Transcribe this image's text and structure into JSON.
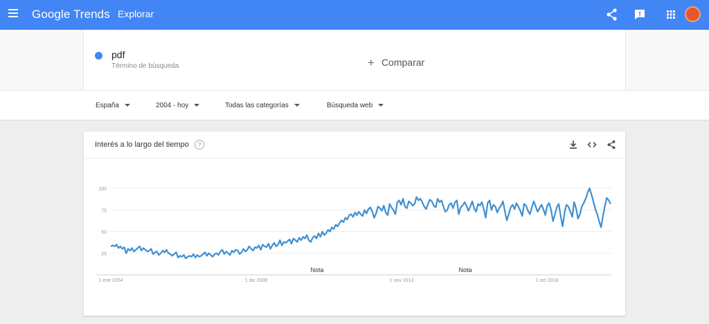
{
  "topbar": {
    "logo_google": "Google",
    "logo_trends": "Trends",
    "explore_label": "Explorar",
    "icons": [
      "menu-icon",
      "share-icon",
      "feedback-icon",
      "apps-icon",
      "avatar"
    ]
  },
  "term": {
    "name": "pdf",
    "subtitle": "Término de búsqueda",
    "color": "#4285f4",
    "compare_label": "Comparar"
  },
  "filters": {
    "region": "España",
    "period": "2004 - hoy",
    "category": "Todas las categorías",
    "search_type": "Búsqueda web"
  },
  "card": {
    "title": "Interés a lo largo del tiempo",
    "icons": [
      "download-icon",
      "embed-icon",
      "share-icon"
    ]
  },
  "chart_data": {
    "type": "line",
    "title": "",
    "xlabel": "",
    "ylabel": "",
    "x_tick_labels": [
      "1 ene 2004",
      "1 dic 2008",
      "1 nov 2013",
      "1 oct 2018"
    ],
    "y_ticks": [
      25,
      50,
      75,
      100
    ],
    "ylim": [
      0,
      100
    ],
    "grid": true,
    "annotations": [
      "Nota",
      "Nota"
    ],
    "series": [
      {
        "name": "pdf",
        "color": "#3d8fd1",
        "values": [
          33,
          34,
          33,
          35,
          31,
          33,
          30,
          32,
          25,
          30,
          28,
          31,
          27,
          29,
          31,
          33,
          28,
          31,
          29,
          27,
          28,
          30,
          24,
          26,
          27,
          23,
          25,
          28,
          26,
          29,
          25,
          24,
          22,
          24,
          26,
          20,
          22,
          21,
          23,
          19,
          21,
          22,
          21,
          24,
          20,
          23,
          21,
          22,
          24,
          26,
          22,
          25,
          23,
          21,
          24,
          25,
          23,
          27,
          29,
          24,
          27,
          25,
          23,
          28,
          26,
          29,
          28,
          24,
          26,
          30,
          27,
          29,
          33,
          30,
          28,
          32,
          31,
          34,
          29,
          35,
          33,
          32,
          36,
          30,
          34,
          37,
          33,
          35,
          40,
          34,
          38,
          37,
          39,
          41,
          36,
          42,
          40,
          38,
          43,
          40,
          44,
          42,
          46,
          40,
          38,
          43,
          45,
          42,
          48,
          44,
          50,
          46,
          48,
          52,
          50,
          55,
          53,
          58,
          56,
          60,
          63,
          61,
          66,
          64,
          69,
          70,
          67,
          72,
          69,
          73,
          70,
          68,
          75,
          71,
          76,
          78,
          73,
          66,
          71,
          79,
          77,
          74,
          80,
          72,
          69,
          82,
          78,
          75,
          70,
          84,
          86,
          81,
          88,
          79,
          77,
          85,
          83,
          80,
          82,
          90,
          86,
          88,
          84,
          79,
          76,
          82,
          87,
          85,
          80,
          78,
          88,
          84,
          86,
          79,
          73,
          75,
          81,
          83,
          77,
          84,
          86,
          70,
          78,
          80,
          84,
          80,
          74,
          79,
          85,
          77,
          73,
          82,
          80,
          84,
          76,
          66,
          83,
          86,
          75,
          81,
          79,
          72,
          77,
          80,
          85,
          73,
          63,
          70,
          78,
          81,
          76,
          83,
          79,
          74,
          68,
          82,
          80,
          74,
          70,
          78,
          85,
          79,
          73,
          77,
          81,
          76,
          69,
          80,
          83,
          75,
          62,
          70,
          78,
          82,
          68,
          56,
          72,
          81,
          79,
          73,
          67,
          84,
          77,
          65,
          70,
          79,
          83,
          88,
          95,
          100,
          93,
          85,
          76,
          70,
          62,
          55,
          68,
          80,
          89,
          86,
          82
        ]
      }
    ]
  }
}
